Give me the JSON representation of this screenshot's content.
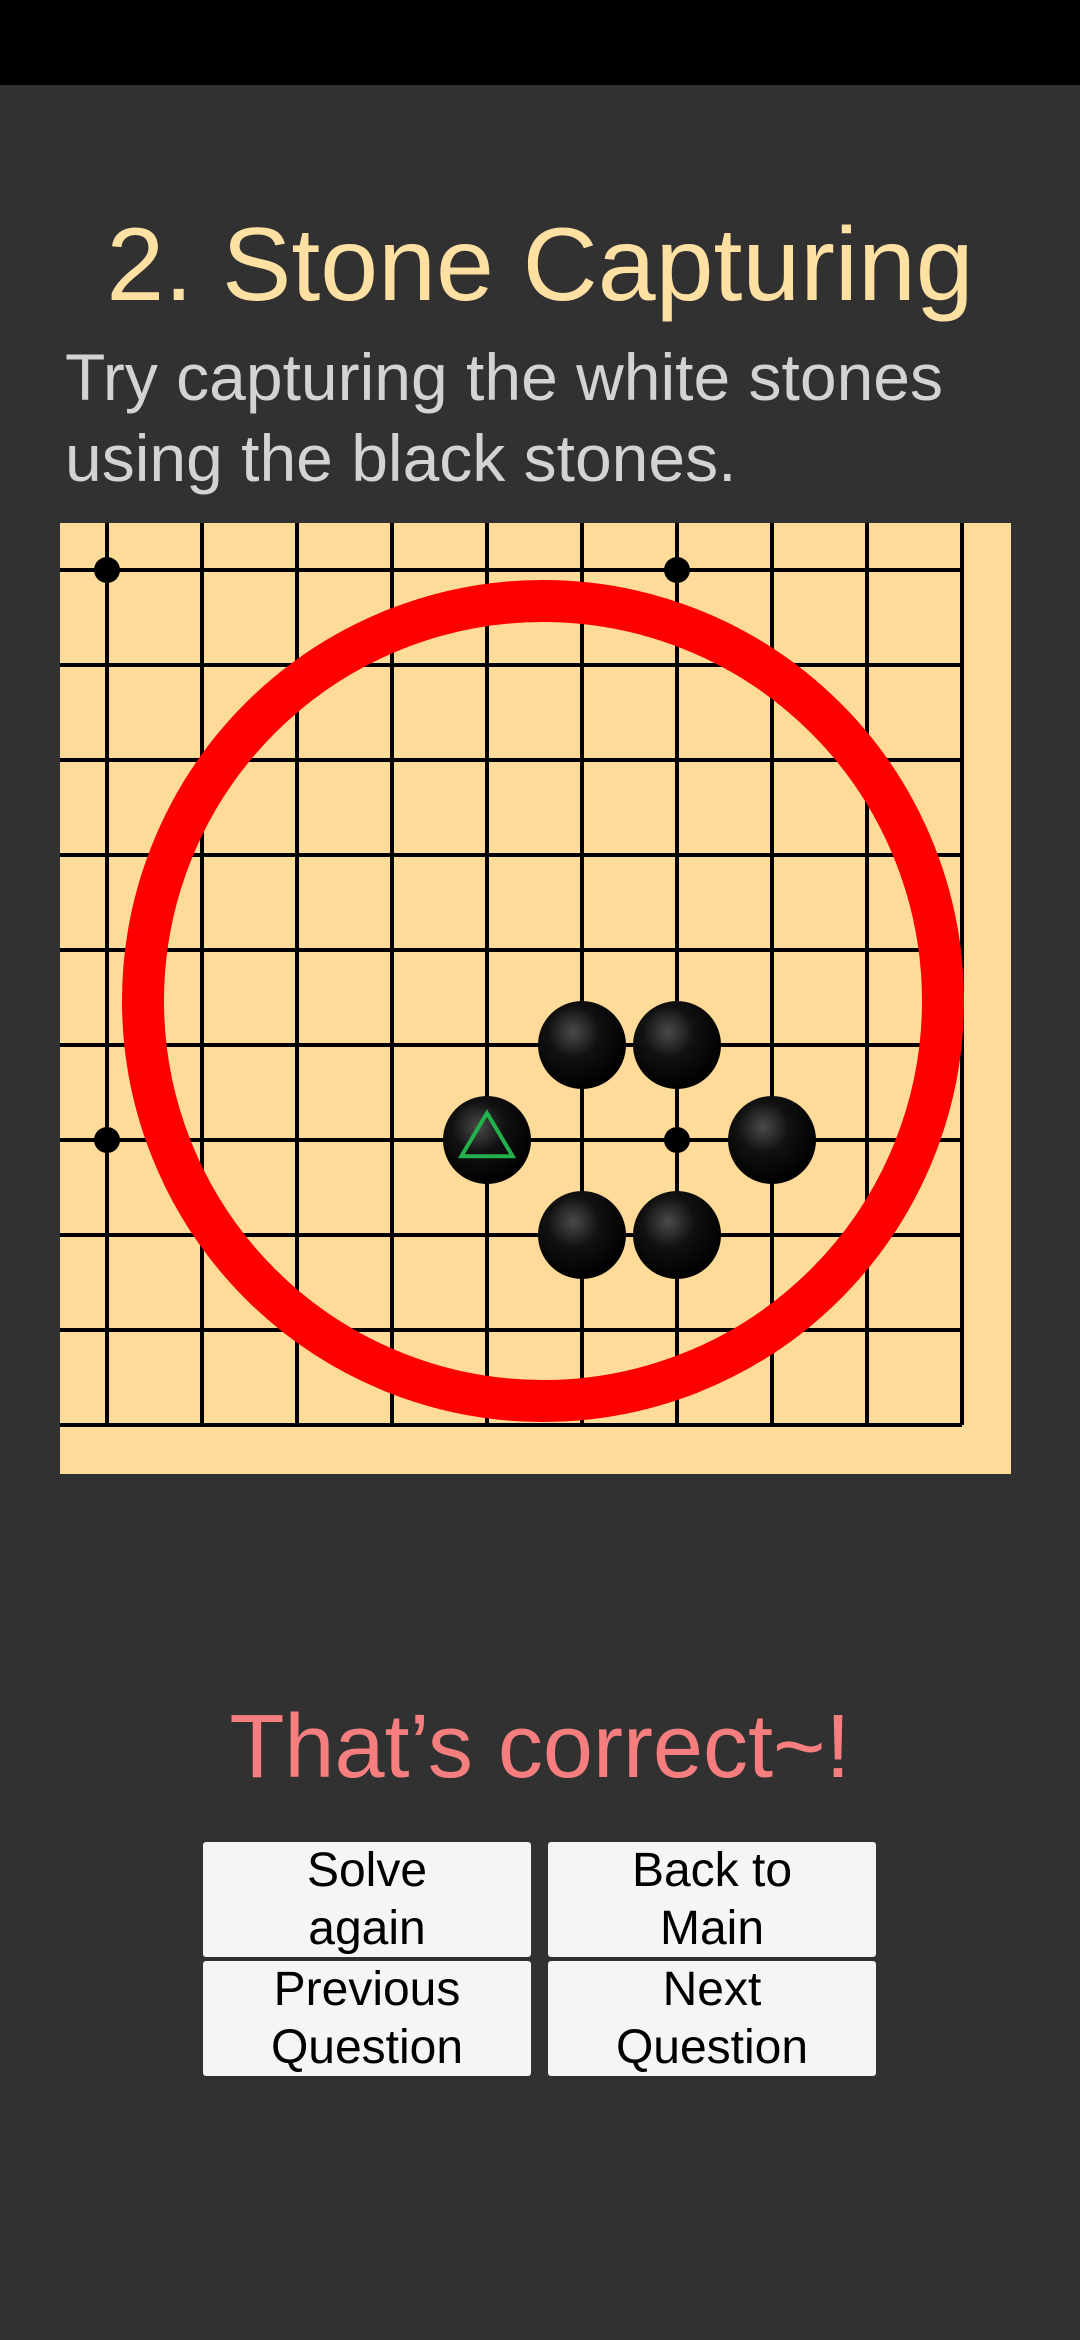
{
  "lesson": {
    "title": "2. Stone Capturing",
    "instruction": "Try capturing the white stones using the black stones."
  },
  "board": {
    "size": 19,
    "visible_columns": 10,
    "visible_rows": 10,
    "colors": {
      "board": "#FFDB99",
      "line": "#000000",
      "stone": "#000000",
      "highlight_circle": "#FF0000",
      "last_move_marker": "#22B14C"
    },
    "star_points": [
      [
        0,
        0
      ],
      [
        6,
        0
      ],
      [
        0,
        6
      ],
      [
        6,
        6
      ]
    ],
    "black_stones": [
      {
        "col": 5,
        "row": 5
      },
      {
        "col": 6,
        "row": 5
      },
      {
        "col": 4,
        "row": 6,
        "last_move": true
      },
      {
        "col": 7,
        "row": 6
      },
      {
        "col": 5,
        "row": 7
      },
      {
        "col": 6,
        "row": 7
      }
    ],
    "last_move_marker_icon": "triangle-icon"
  },
  "result": {
    "message": "That’s correct~!"
  },
  "buttons": {
    "solve_again": "Solve\n again",
    "back_to_main": "Back to\n Main",
    "previous_question": "Previous\n Question",
    "next_question": "Next\n Question"
  }
}
